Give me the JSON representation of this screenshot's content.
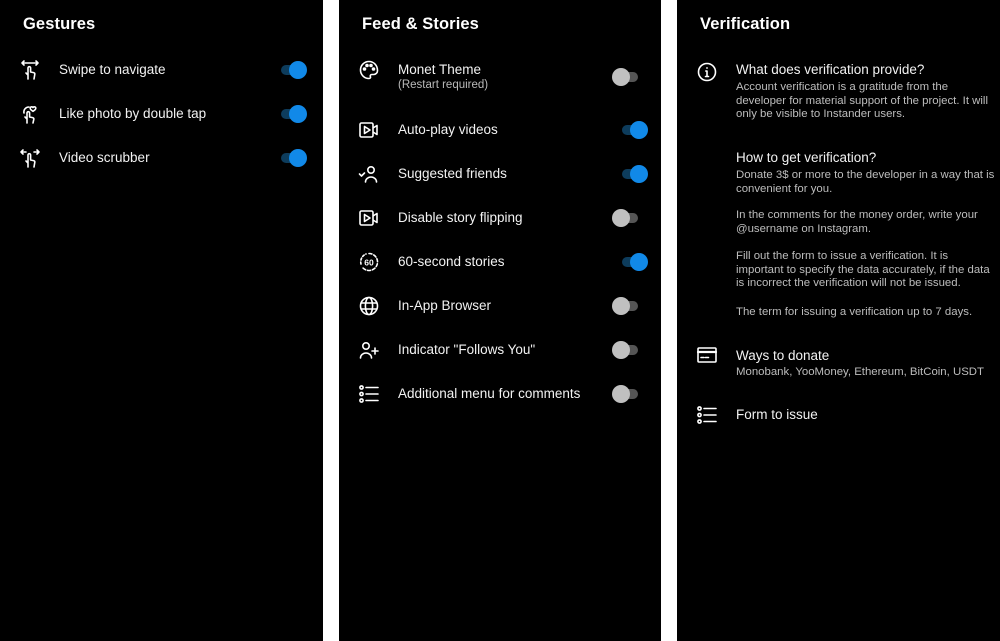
{
  "gestures": {
    "title": "Gestures",
    "items": [
      {
        "label": "Swipe to navigate",
        "icon": "swipe-gesture-icon",
        "enabled": true
      },
      {
        "label": "Like photo by double tap",
        "icon": "double-tap-like-icon",
        "enabled": true
      },
      {
        "label": "Video scrubber",
        "icon": "scrub-gesture-icon",
        "enabled": true
      }
    ]
  },
  "feed": {
    "title": "Feed & Stories",
    "items": [
      {
        "label": "Monet Theme",
        "sub": "(Restart required)",
        "icon": "palette-icon",
        "enabled": false
      },
      {
        "label": "Auto-play videos",
        "icon": "video-play-icon",
        "enabled": true
      },
      {
        "label": "Suggested friends",
        "icon": "person-check-icon",
        "enabled": true
      },
      {
        "label": "Disable story flipping",
        "icon": "video-play-icon",
        "enabled": false
      },
      {
        "label": "60-second stories",
        "icon": "timer-60-icon",
        "enabled": true
      },
      {
        "label": "In-App Browser",
        "icon": "globe-icon",
        "enabled": false
      },
      {
        "label": "Indicator \"Follows You\"",
        "icon": "person-add-icon",
        "enabled": false
      },
      {
        "label": "Additional menu for comments",
        "icon": "list-icon",
        "enabled": false
      }
    ]
  },
  "verification": {
    "title": "Verification",
    "what": {
      "heading": "What does verification provide?",
      "text": "Account verification is a gratitude from the developer for material support of the project. It will only be visible to Instander users."
    },
    "how": {
      "heading": "How to get verification?",
      "paragraphs": [
        "Donate 3$ or more to the developer in a way that is convenient for you.",
        "In the comments for the money order, write your @username on Instagram.",
        "Fill out the form to issue a verification. It is important to specify the data accurately, if the data is incorrect the verification will not be issued.",
        "The term for issuing a verification up to 7 days."
      ]
    },
    "donate": {
      "heading": "Ways to donate",
      "text": "Monobank, YooMoney, Ethereum, BitCoin, USDT"
    },
    "form": {
      "heading": "Form to issue"
    }
  },
  "colors": {
    "accent": "#1189e8",
    "accent_track": "#0d3c5c",
    "off_thumb": "#c0c0c0",
    "off_track": "#555555",
    "background": "#000000",
    "separator": "#ffffff"
  }
}
